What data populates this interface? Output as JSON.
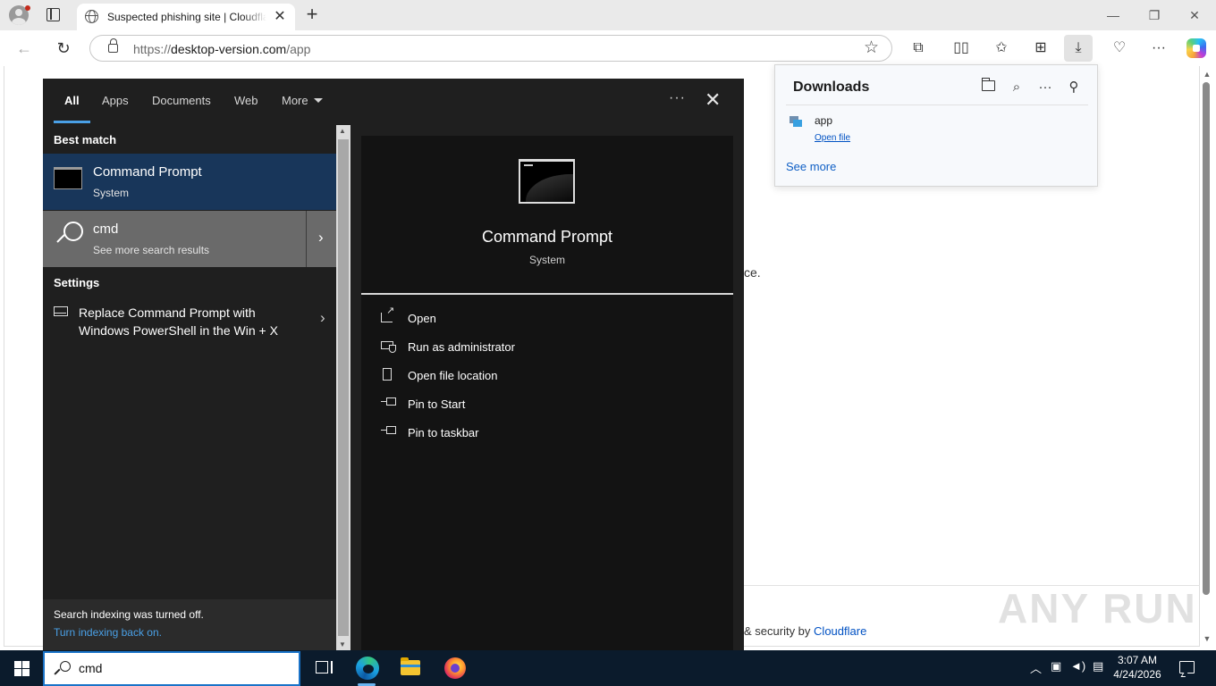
{
  "browser": {
    "tab_title": "Suspected phishing site | Cloudflare",
    "tab_close": "✕",
    "new_tab": "+",
    "url_prefix": "https://",
    "url_host": "desktop-version.com",
    "url_path": "/app",
    "window_controls": {
      "minimize": "—",
      "restore": "❐",
      "close": "✕"
    }
  },
  "page": {
    "partial_text": "ce.",
    "footer_prefix": "& security by",
    "footer_link": "Cloudflare",
    "watermark": "ANY RUN"
  },
  "downloads": {
    "title": "Downloads",
    "items": [
      {
        "name": "app",
        "action": "Open file"
      }
    ],
    "see_more": "See more"
  },
  "start_search": {
    "tabs": [
      {
        "label": "All",
        "active": true
      },
      {
        "label": "Apps"
      },
      {
        "label": "Documents"
      },
      {
        "label": "Web"
      },
      {
        "label": "More"
      }
    ],
    "more_options": "···",
    "close": "✕",
    "best_match_header": "Best match",
    "best_match": {
      "title": "Command Prompt",
      "subtitle": "System"
    },
    "web_result": {
      "title": "cmd",
      "subtitle": "See more search results"
    },
    "settings_header": "Settings",
    "settings_item": "Replace Command Prompt with Windows PowerShell in the Win + X",
    "notice": {
      "line1": "Search indexing was turned off.",
      "link": "Turn indexing back on."
    },
    "detail": {
      "title": "Command Prompt",
      "subtitle": "System",
      "actions": [
        "Open",
        "Run as administrator",
        "Open file location",
        "Pin to Start",
        "Pin to taskbar"
      ]
    }
  },
  "taskbar": {
    "search_text": "cmd",
    "clock": {
      "time": "3:07 AM",
      "date": "4/24/2026"
    },
    "tray_icons": [
      "chevron-up-icon",
      "camera-icon",
      "volume-icon",
      "network-icon"
    ]
  },
  "colors": {
    "accent": "#4aa0e6",
    "best_match_bg": "#18365a",
    "taskbar_bg": "#0b1b2c",
    "link_blue": "#0051c3"
  }
}
